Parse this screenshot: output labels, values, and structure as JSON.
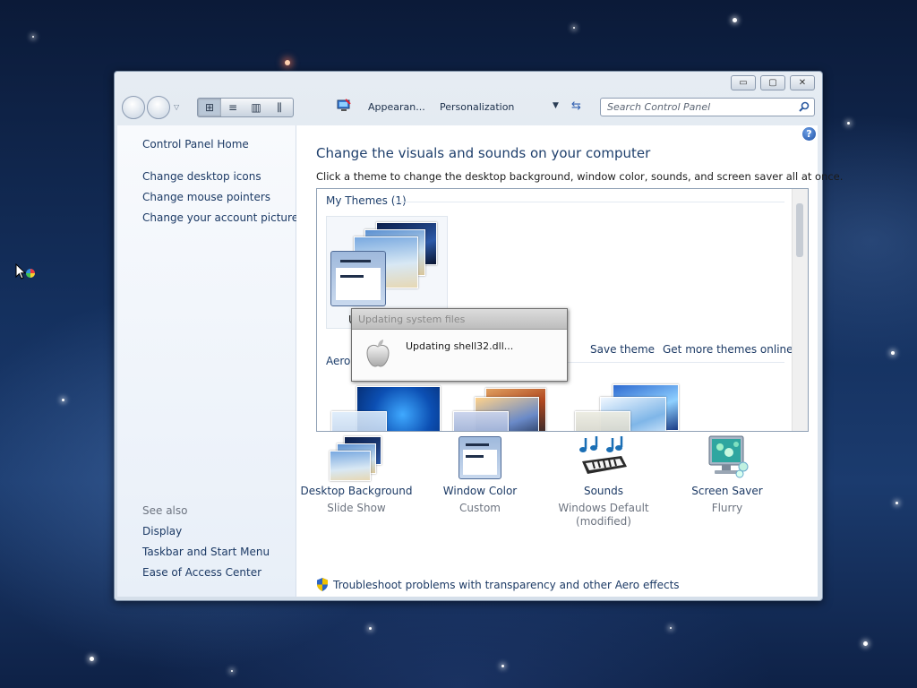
{
  "window": {
    "caption_buttons": {
      "minimize": "▭",
      "maximize": "▢",
      "close": "✕"
    }
  },
  "toolbar": {
    "view_buttons": [
      "⊞",
      "≡",
      "▥",
      "⫼"
    ],
    "breadcrumbs": [
      "Appearan...",
      "Personalization"
    ],
    "dropdown_glyph": "▼",
    "refresh_glyph": "⇆",
    "search_placeholder": "Search Control Panel"
  },
  "sidebar": {
    "home": "Control Panel Home",
    "links": [
      "Change desktop icons",
      "Change mouse pointers",
      "Change your account picture"
    ],
    "see_also_label": "See also",
    "see_also": [
      "Display",
      "Taskbar and Start Menu",
      "Ease of Access Center"
    ]
  },
  "main": {
    "help_glyph": "?",
    "title": "Change the visuals and sounds on your computer",
    "subtitle": "Click a theme to change the desktop background, window color, sounds, and screen saver all at once.",
    "my_themes_label": "My Themes (1)",
    "theme_tile_letter": "U",
    "save_theme": "Save theme",
    "get_more_themes": "Get more themes online",
    "aero_label": "Aero",
    "features": [
      {
        "name": "Desktop Background",
        "sub": "Slide Show"
      },
      {
        "name": "Window Color",
        "sub": "Custom"
      },
      {
        "name": "Sounds",
        "sub": "Windows Default (modified)"
      },
      {
        "name": "Screen Saver",
        "sub": "Flurry"
      }
    ],
    "troubleshoot": "Troubleshoot problems with transparency and other Aero effects"
  },
  "dialog": {
    "title": "Updating system files",
    "message": "Updating shell32.dll..."
  },
  "colors": {
    "link": "#1c3a65",
    "heading": "#1e3f6c",
    "muted": "#6d7480"
  }
}
